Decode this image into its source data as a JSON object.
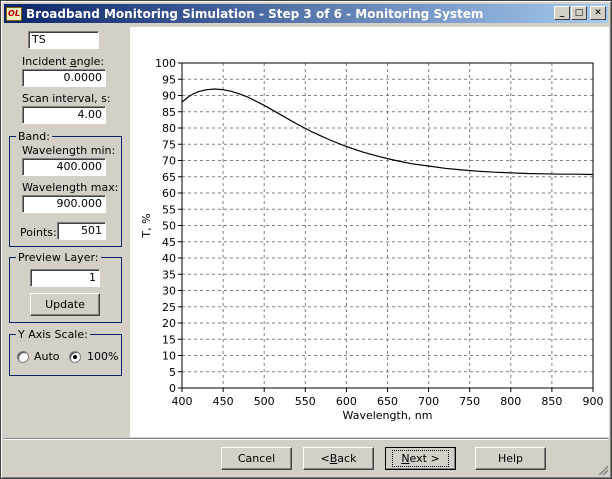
{
  "window": {
    "icon_text": "OL",
    "title": "Broadband Monitoring Simulation - Step 3 of 6 - Monitoring System",
    "minimize_glyph": "_",
    "maximize_glyph": "□",
    "close_glyph": "✕"
  },
  "left_panel": {
    "ts_value": "TS",
    "incident_angle_label_pre": "Incident ",
    "incident_angle_label_accel": "a",
    "incident_angle_label_post": "ngle:",
    "incident_angle_value": "0.0000",
    "scan_interval_label": "Scan interval, s:",
    "scan_interval_value": "4.00",
    "band": {
      "title": "Band:",
      "wl_min_label": "Wavelength min:",
      "wl_min_value": "400.000",
      "wl_max_label": "Wavelength max:",
      "wl_max_value": "900.000",
      "points_label": "Points:",
      "points_value": "501"
    },
    "preview": {
      "title": "Preview Layer:",
      "layer_value": "1",
      "update_label": "Update"
    },
    "y_axis_scale": {
      "title": "Y Axis Scale:",
      "auto_label": "Auto",
      "pct_label": "100%",
      "selected": "100%"
    }
  },
  "footer": {
    "cancel_label": "Cancel",
    "back_accel": "B",
    "back_pre": "< ",
    "back_post": "ack",
    "next_accel": "N",
    "next_post": "ext >",
    "help_label": "Help"
  },
  "chart_data": {
    "type": "line",
    "title": "",
    "xlabel": "Wavelength, nm",
    "ylabel": "T, %",
    "xlim": [
      400,
      900
    ],
    "ylim": [
      0,
      100
    ],
    "xticks": [
      400,
      450,
      500,
      550,
      600,
      650,
      700,
      750,
      800,
      850,
      900
    ],
    "yticks": [
      0,
      5,
      10,
      15,
      20,
      25,
      30,
      35,
      40,
      45,
      50,
      55,
      60,
      65,
      70,
      75,
      80,
      85,
      90,
      95,
      100
    ],
    "grid": true,
    "legend": "none",
    "line_color": "#000000",
    "series": [
      {
        "x": [
          400,
          410,
          420,
          430,
          440,
          450,
          460,
          470,
          480,
          500,
          520,
          540,
          560,
          580,
          600,
          620,
          640,
          660,
          680,
          700,
          720,
          740,
          760,
          780,
          800,
          820,
          840,
          860,
          880,
          900
        ],
        "values": [
          88.0,
          90.0,
          91.2,
          91.8,
          92.0,
          91.8,
          91.3,
          90.5,
          89.5,
          87.0,
          84.1,
          81.2,
          78.6,
          76.3,
          74.3,
          72.6,
          71.2,
          70.0,
          69.0,
          68.3,
          67.6,
          67.1,
          66.7,
          66.4,
          66.2,
          66.0,
          65.9,
          65.8,
          65.8,
          65.7
        ]
      }
    ]
  }
}
